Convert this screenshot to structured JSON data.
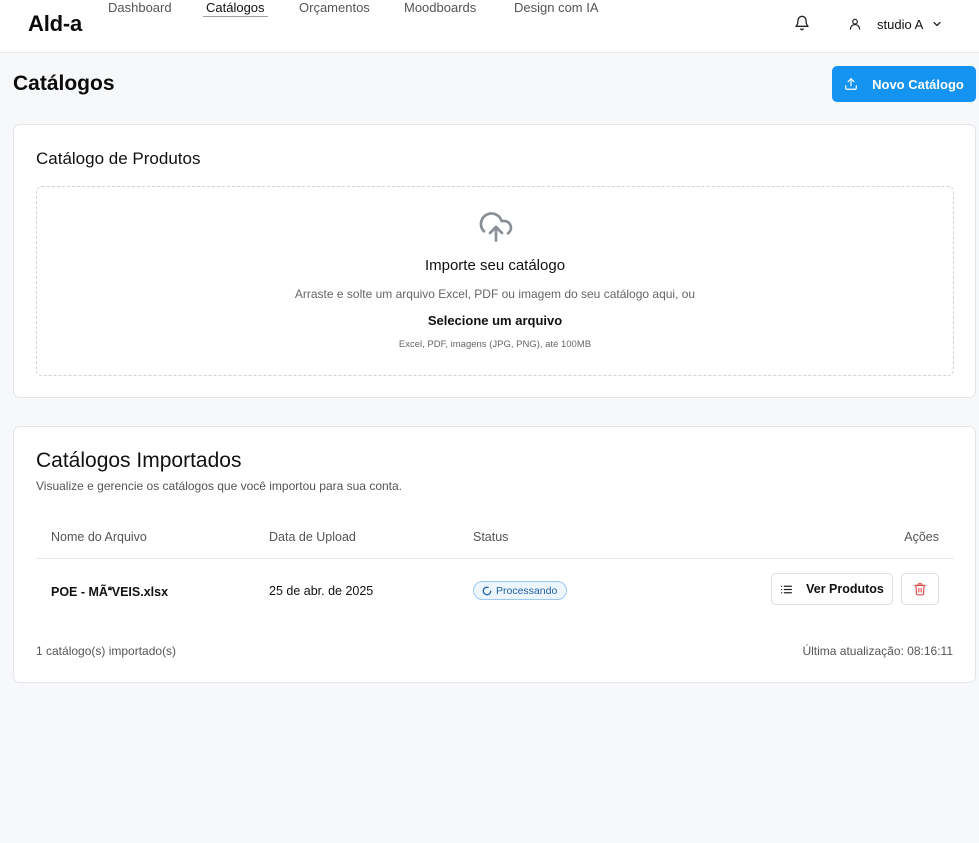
{
  "app": {
    "logo": "Ald-a"
  },
  "nav": {
    "items": [
      {
        "label": "Dashboard"
      },
      {
        "label": "Catálogos"
      },
      {
        "label": "Orçamentos"
      },
      {
        "label": "Moodboards"
      },
      {
        "label": "Design com IA"
      }
    ],
    "active": "Catálogos"
  },
  "header": {
    "user_name": "studio A",
    "icons": [
      "bell-icon",
      "user-icon",
      "chevron-down-icon"
    ]
  },
  "page": {
    "title": "Catálogos",
    "new_button_label": "Novo Catálogo"
  },
  "upload_card": {
    "title": "Catálogo de Produtos",
    "drop_title": "Importe seu catálogo",
    "drop_subtitle": "Arraste e solte um arquivo Excel, PDF ou imagem do seu catálogo aqui, ou",
    "select_label": "Selecione um arquivo",
    "formats": "Excel, PDF, imagens (JPG, PNG), até 100MB"
  },
  "imported_card": {
    "title": "Catálogos Importados",
    "description": "Visualize e gerencie os catálogos que você importou para sua conta.",
    "columns": [
      "Nome do Arquivo",
      "Data de Upload",
      "Status",
      "Ações"
    ],
    "rows": [
      {
        "filename": "POE - MÃVEIS.xlsx",
        "date": "25 de abr. de 2025",
        "status": "Processando",
        "view_label": "Ver Produtos"
      }
    ],
    "count_text": "1 catálogo(s) importado(s)",
    "updated_text": "Última atualização: 08:16:11"
  },
  "colors": {
    "primary": "#1593f0",
    "badge_text": "#1b5fa6",
    "delete": "#e05252"
  }
}
